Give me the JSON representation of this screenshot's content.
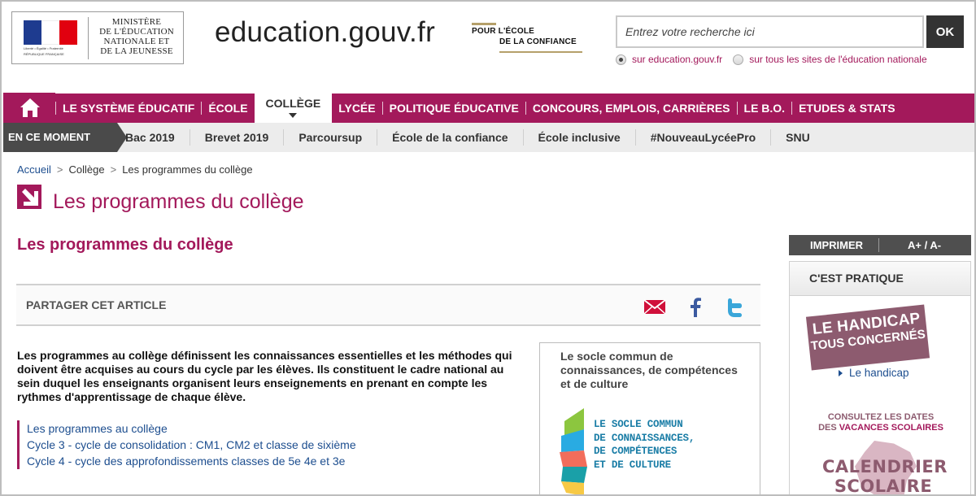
{
  "header": {
    "ministry_lines": [
      "MINISTÈRE",
      "DE L'ÉDUCATION",
      "NATIONALE ET",
      "DE LA JEUNESSE"
    ],
    "marianne_motto": "Liberté • Égalité • Fraternité",
    "marianne_country": "RÉPUBLIQUE FRANÇAISE",
    "site_title": "education.gouv.fr",
    "confiance_line1": "POUR L'ÉCOLE",
    "confiance_line2": "DE LA CONFIANCE"
  },
  "search": {
    "placeholder": "Entrez votre recherche ici",
    "button_label": "OK",
    "scope_options": [
      "sur education.gouv.fr",
      "sur tous les sites de l'éducation nationale"
    ],
    "selected_scope": "sur education.gouv.fr"
  },
  "main_nav": {
    "items": [
      "LE SYSTÈME ÉDUCATIF",
      "ÉCOLE",
      "COLLÈGE",
      "LYCÉE",
      "POLITIQUE ÉDUCATIVE",
      "CONCOURS, EMPLOIS, CARRIÈRES",
      "LE B.O.",
      "ETUDES & STATS"
    ],
    "active": "COLLÈGE"
  },
  "sub_nav": {
    "label": "EN CE MOMENT",
    "items": [
      "Bac 2019",
      "Brevet 2019",
      "Parcoursup",
      "École de la confiance",
      "École inclusive",
      "#NouveauLycéePro",
      "SNU"
    ]
  },
  "breadcrumb": {
    "items": [
      "Accueil",
      "Collège",
      "Les programmes du collège"
    ],
    "separator": ">"
  },
  "page": {
    "title": "Les programmes du collège",
    "article_title": "Les programmes du collège",
    "share_label": "PARTAGER CET ARTICLE",
    "intro": "Les programmes au collège définissent les connaissances essentielles et les méthodes qui doivent être acquises au cours du cycle par les élèves. Ils constituent le cadre national au sein duquel les enseignants organisent leurs enseignements en prenant en compte les rythmes d'apprentissage de chaque élève.",
    "links": [
      "Les programmes au collège",
      "Cycle 3 - cycle de consolidation : CM1, CM2 et classe de sixième",
      "Cycle 4 - cycle des approfondissements classes de 5e 4e et 3e"
    ]
  },
  "socle": {
    "title": "Le socle commun de connaissances, de compétences et de culture",
    "logo_lines": [
      "LE SOCLE COMMUN",
      "DE CONNAISSANCES,",
      "DE COMPÉTENCES",
      "ET DE CULTURE"
    ]
  },
  "sidebar": {
    "print_label": "IMPRIMER",
    "font_size_label": "A+ / A-",
    "heading": "C'EST PRATIQUE",
    "handicap_line1": "LE HANDICAP",
    "handicap_line2": "TOUS CONCERNÉS",
    "handicap_link": "Le handicap",
    "vacances_line1": "CONSULTEZ LES DATES",
    "vacances_line2_prefix": "DES ",
    "vacances_line2_em": "VACANCES SCOLAIRES",
    "calendrier_line1": "CALENDRIER",
    "calendrier_line2": "SCOLAIRE"
  },
  "colors": {
    "brand": "#a3195b",
    "link": "#1d4e8f",
    "dark": "#4a4a4a",
    "handicap": "#8d5b6f"
  },
  "icons": [
    "home-icon",
    "mail-icon",
    "facebook-icon",
    "twitter-icon",
    "arrow-down-right-icon",
    "radio-icon",
    "triangle-right-icon"
  ]
}
